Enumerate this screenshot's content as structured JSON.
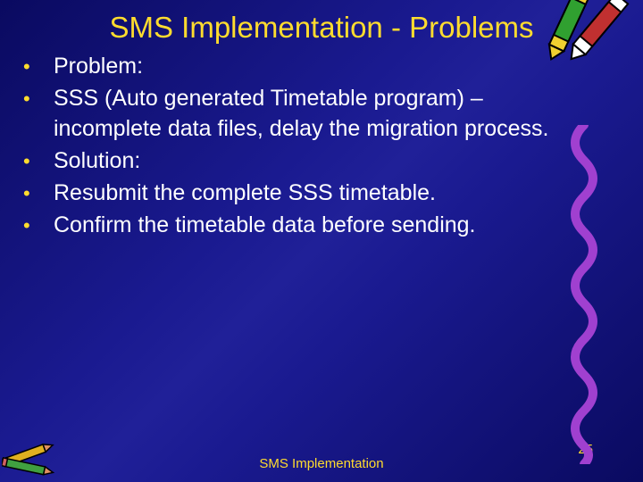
{
  "title": "SMS Implementation - Problems",
  "bullets": [
    "Problem:",
    "SSS (Auto generated Timetable program) – incomplete data files, delay the migration process.",
    "Solution:",
    "Resubmit the complete SSS timetable.",
    "Confirm the timetable data before sending."
  ],
  "footer": "SMS Implementation",
  "page_number": "25"
}
